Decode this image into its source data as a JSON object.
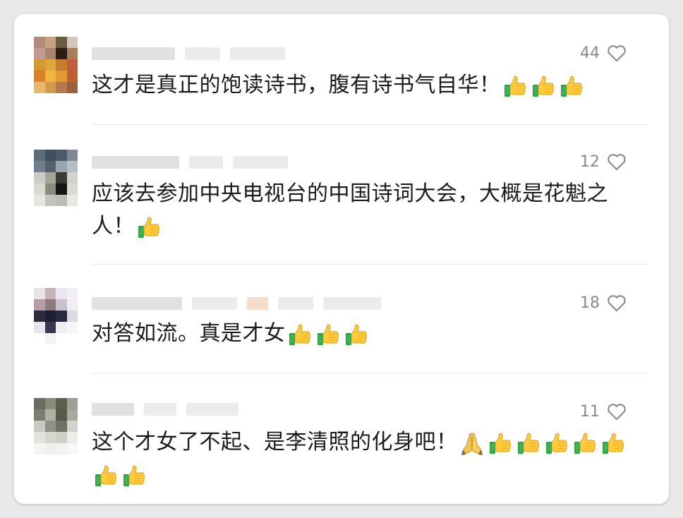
{
  "comments": [
    {
      "likes": "44",
      "text": "这才是真正的饱读诗书，腹有诗书气自华！",
      "emojis": [
        "thumbs-up",
        "thumbs-up",
        "thumbs-up"
      ]
    },
    {
      "likes": "12",
      "text": "应该去参加中央电视台的中国诗词大会，大概是花魁之人！",
      "emojis": [
        "thumbs-up"
      ]
    },
    {
      "likes": "18",
      "text": "对答如流。真是才女",
      "emojis": [
        "thumbs-up",
        "thumbs-up",
        "thumbs-up"
      ]
    },
    {
      "likes": "11",
      "text": "这个才女了不起、是李清照的化身吧！",
      "emojis": [
        "folded-hands",
        "thumbs-up",
        "thumbs-up",
        "thumbs-up",
        "thumbs-up",
        "thumbs-up",
        "thumbs-up",
        "thumbs-up"
      ]
    }
  ],
  "colors": {
    "background": "#ffffff",
    "text": "#1b1b1b",
    "likes": "#8a8a8a",
    "divider": "#e6e6e6"
  }
}
